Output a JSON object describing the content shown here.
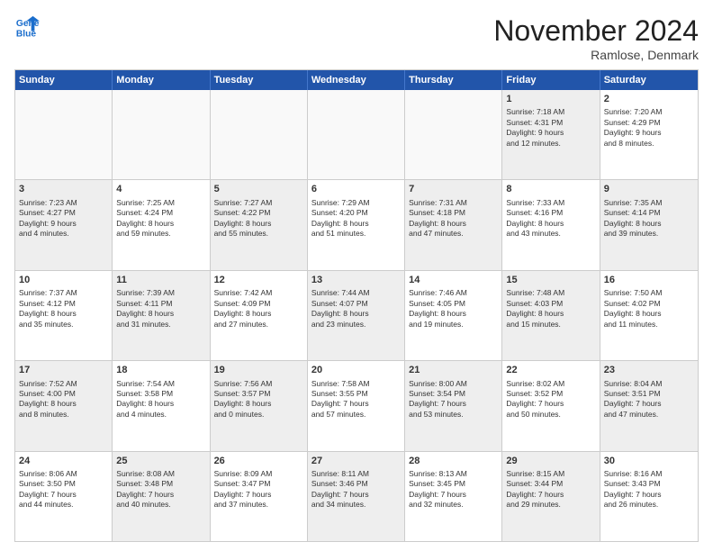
{
  "logo": {
    "line1": "General",
    "line2": "Blue"
  },
  "title": "November 2024",
  "location": "Ramlose, Denmark",
  "days_of_week": [
    "Sunday",
    "Monday",
    "Tuesday",
    "Wednesday",
    "Thursday",
    "Friday",
    "Saturday"
  ],
  "weeks": [
    [
      {
        "num": "",
        "info": "",
        "empty": true
      },
      {
        "num": "",
        "info": "",
        "empty": true
      },
      {
        "num": "",
        "info": "",
        "empty": true
      },
      {
        "num": "",
        "info": "",
        "empty": true
      },
      {
        "num": "",
        "info": "",
        "empty": true
      },
      {
        "num": "1",
        "info": "Sunrise: 7:18 AM\nSunset: 4:31 PM\nDaylight: 9 hours\nand 12 minutes.",
        "shaded": true
      },
      {
        "num": "2",
        "info": "Sunrise: 7:20 AM\nSunset: 4:29 PM\nDaylight: 9 hours\nand 8 minutes.",
        "shaded": false
      }
    ],
    [
      {
        "num": "3",
        "info": "Sunrise: 7:23 AM\nSunset: 4:27 PM\nDaylight: 9 hours\nand 4 minutes.",
        "shaded": true
      },
      {
        "num": "4",
        "info": "Sunrise: 7:25 AM\nSunset: 4:24 PM\nDaylight: 8 hours\nand 59 minutes.",
        "shaded": false
      },
      {
        "num": "5",
        "info": "Sunrise: 7:27 AM\nSunset: 4:22 PM\nDaylight: 8 hours\nand 55 minutes.",
        "shaded": true
      },
      {
        "num": "6",
        "info": "Sunrise: 7:29 AM\nSunset: 4:20 PM\nDaylight: 8 hours\nand 51 minutes.",
        "shaded": false
      },
      {
        "num": "7",
        "info": "Sunrise: 7:31 AM\nSunset: 4:18 PM\nDaylight: 8 hours\nand 47 minutes.",
        "shaded": true
      },
      {
        "num": "8",
        "info": "Sunrise: 7:33 AM\nSunset: 4:16 PM\nDaylight: 8 hours\nand 43 minutes.",
        "shaded": false
      },
      {
        "num": "9",
        "info": "Sunrise: 7:35 AM\nSunset: 4:14 PM\nDaylight: 8 hours\nand 39 minutes.",
        "shaded": true
      }
    ],
    [
      {
        "num": "10",
        "info": "Sunrise: 7:37 AM\nSunset: 4:12 PM\nDaylight: 8 hours\nand 35 minutes.",
        "shaded": false
      },
      {
        "num": "11",
        "info": "Sunrise: 7:39 AM\nSunset: 4:11 PM\nDaylight: 8 hours\nand 31 minutes.",
        "shaded": true
      },
      {
        "num": "12",
        "info": "Sunrise: 7:42 AM\nSunset: 4:09 PM\nDaylight: 8 hours\nand 27 minutes.",
        "shaded": false
      },
      {
        "num": "13",
        "info": "Sunrise: 7:44 AM\nSunset: 4:07 PM\nDaylight: 8 hours\nand 23 minutes.",
        "shaded": true
      },
      {
        "num": "14",
        "info": "Sunrise: 7:46 AM\nSunset: 4:05 PM\nDaylight: 8 hours\nand 19 minutes.",
        "shaded": false
      },
      {
        "num": "15",
        "info": "Sunrise: 7:48 AM\nSunset: 4:03 PM\nDaylight: 8 hours\nand 15 minutes.",
        "shaded": true
      },
      {
        "num": "16",
        "info": "Sunrise: 7:50 AM\nSunset: 4:02 PM\nDaylight: 8 hours\nand 11 minutes.",
        "shaded": false
      }
    ],
    [
      {
        "num": "17",
        "info": "Sunrise: 7:52 AM\nSunset: 4:00 PM\nDaylight: 8 hours\nand 8 minutes.",
        "shaded": true
      },
      {
        "num": "18",
        "info": "Sunrise: 7:54 AM\nSunset: 3:58 PM\nDaylight: 8 hours\nand 4 minutes.",
        "shaded": false
      },
      {
        "num": "19",
        "info": "Sunrise: 7:56 AM\nSunset: 3:57 PM\nDaylight: 8 hours\nand 0 minutes.",
        "shaded": true
      },
      {
        "num": "20",
        "info": "Sunrise: 7:58 AM\nSunset: 3:55 PM\nDaylight: 7 hours\nand 57 minutes.",
        "shaded": false
      },
      {
        "num": "21",
        "info": "Sunrise: 8:00 AM\nSunset: 3:54 PM\nDaylight: 7 hours\nand 53 minutes.",
        "shaded": true
      },
      {
        "num": "22",
        "info": "Sunrise: 8:02 AM\nSunset: 3:52 PM\nDaylight: 7 hours\nand 50 minutes.",
        "shaded": false
      },
      {
        "num": "23",
        "info": "Sunrise: 8:04 AM\nSunset: 3:51 PM\nDaylight: 7 hours\nand 47 minutes.",
        "shaded": true
      }
    ],
    [
      {
        "num": "24",
        "info": "Sunrise: 8:06 AM\nSunset: 3:50 PM\nDaylight: 7 hours\nand 44 minutes.",
        "shaded": false
      },
      {
        "num": "25",
        "info": "Sunrise: 8:08 AM\nSunset: 3:48 PM\nDaylight: 7 hours\nand 40 minutes.",
        "shaded": true
      },
      {
        "num": "26",
        "info": "Sunrise: 8:09 AM\nSunset: 3:47 PM\nDaylight: 7 hours\nand 37 minutes.",
        "shaded": false
      },
      {
        "num": "27",
        "info": "Sunrise: 8:11 AM\nSunset: 3:46 PM\nDaylight: 7 hours\nand 34 minutes.",
        "shaded": true
      },
      {
        "num": "28",
        "info": "Sunrise: 8:13 AM\nSunset: 3:45 PM\nDaylight: 7 hours\nand 32 minutes.",
        "shaded": false
      },
      {
        "num": "29",
        "info": "Sunrise: 8:15 AM\nSunset: 3:44 PM\nDaylight: 7 hours\nand 29 minutes.",
        "shaded": true
      },
      {
        "num": "30",
        "info": "Sunrise: 8:16 AM\nSunset: 3:43 PM\nDaylight: 7 hours\nand 26 minutes.",
        "shaded": false
      }
    ]
  ]
}
